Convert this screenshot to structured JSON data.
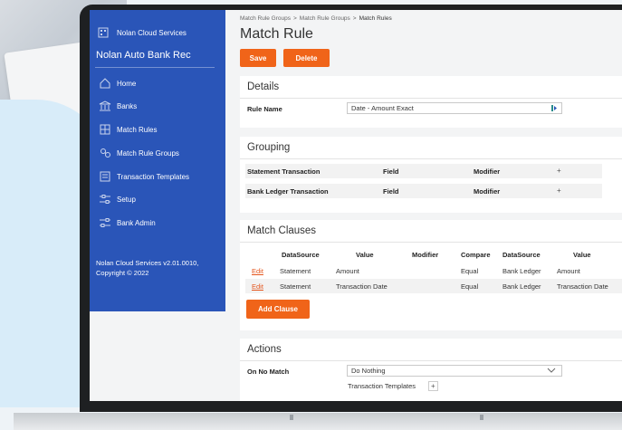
{
  "sidebar": {
    "brand": "Nolan Cloud Services",
    "app_name": "Nolan Auto Bank Rec",
    "items": [
      {
        "label": "Home"
      },
      {
        "label": "Banks"
      },
      {
        "label": "Match Rules"
      },
      {
        "label": "Match Rule Groups"
      },
      {
        "label": "Transaction Templates"
      },
      {
        "label": "Setup"
      },
      {
        "label": "Bank Admin"
      }
    ],
    "footer_version": "Nolan Cloud Services v2.01.0010,",
    "footer_copyright": "Copyright © 2022"
  },
  "breadcrumb": {
    "items": [
      "Match Rule Groups",
      "Match Rule Groups",
      "Match Rules"
    ],
    "separator": ">"
  },
  "page": {
    "title": "Match Rule"
  },
  "toolbar": {
    "save_label": "Save",
    "delete_label": "Delete"
  },
  "details": {
    "title": "Details",
    "rule_name_label": "Rule Name",
    "rule_name_value": "Date - Amount Exact"
  },
  "grouping": {
    "title": "Grouping",
    "rows": [
      {
        "label": "Statement Transaction",
        "field": "Field",
        "modifier": "Modifier",
        "add": "+"
      },
      {
        "label": "Bank Ledger Transaction",
        "field": "Field",
        "modifier": "Modifier",
        "add": "+"
      }
    ]
  },
  "match_clauses": {
    "title": "Match Clauses",
    "headers": [
      "DataSource",
      "Value",
      "Modifier",
      "Compare",
      "DataSource",
      "Value"
    ],
    "rows": [
      {
        "action": "Edit",
        "ds1": "Statement",
        "value1": "Amount",
        "modifier": "",
        "compare": "Equal",
        "ds2": "Bank Ledger",
        "value2": "Amount"
      },
      {
        "action": "Edit",
        "ds1": "Statement",
        "value1": "Transaction Date",
        "modifier": "",
        "compare": "Equal",
        "ds2": "Bank Ledger",
        "value2": "Transaction Date"
      }
    ],
    "add_label": "Add Clause"
  },
  "actions": {
    "title": "Actions",
    "on_no_match_label": "On No Match",
    "on_no_match_value": "Do Nothing",
    "templates_label": "Transaction Templates",
    "templates_add": "+"
  },
  "colors": {
    "accent": "#f06419",
    "sidebar": "#2a55b8",
    "link": "#e4551d"
  }
}
